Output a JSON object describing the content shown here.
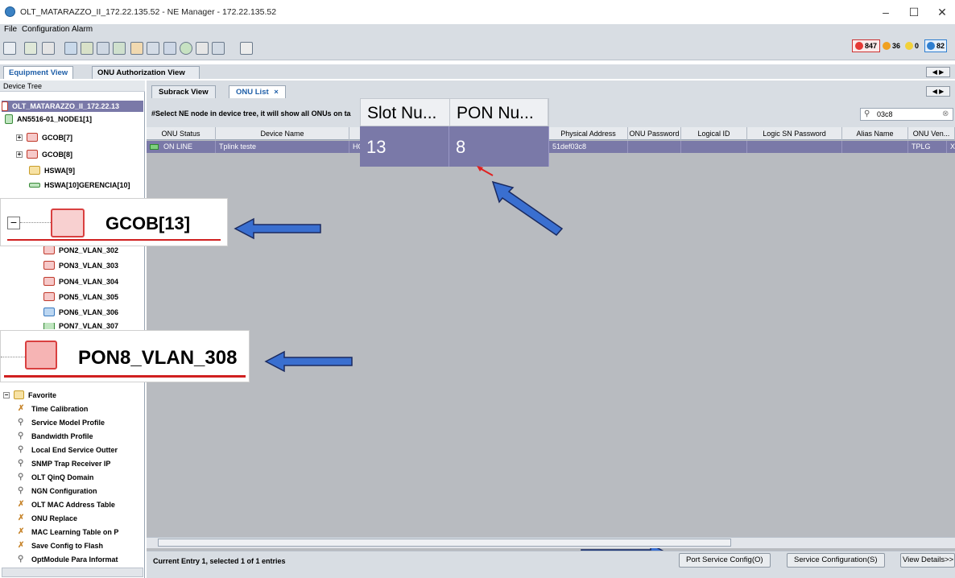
{
  "window": {
    "title": "OLT_MATARAZZO_II_172.22.135.52 - NE Manager - 172.22.135.52",
    "minimize": "–",
    "maximize": "☐",
    "close": "✕"
  },
  "menu": {
    "file": "File",
    "configuration": "Configuration",
    "alarm": "Alarm"
  },
  "alarms": {
    "critical": "847",
    "major": "36",
    "minor": "0",
    "warning": "82",
    "colors": {
      "critical": "#e53935",
      "major": "#f0a020",
      "minor": "#f2d13a",
      "warning": "#2f7fd0"
    }
  },
  "main_tabs": {
    "equipment": "Equipment View",
    "onu_auth": "ONU Authorization View",
    "close": "×"
  },
  "tree": {
    "header": "Device Tree",
    "root": "OLT_MATARAZZO_II_172.22.13",
    "node": "AN5516-01_NODE1[1]",
    "items": [
      "GCOB[7]",
      "GCOB[8]",
      "HSWA[9]",
      "HSWA[10]GERENCIA[10]"
    ],
    "pons": [
      "PON2_VLAN_302",
      "PON3_VLAN_303",
      "PON4_VLAN_304",
      "PON5_VLAN_305",
      "PON6_VLAN_306",
      "PON7_VLAN_307"
    ],
    "favorite": "Favorite",
    "favorites": [
      "Time Calibration",
      "Service Model Profile",
      "Bandwidth Profile",
      "Local End Service Outter",
      "SNMP Trap Receiver IP",
      "OLT QinQ Domain",
      "NGN Configuration",
      "OLT MAC Address Table",
      "ONU Replace",
      "MAC Learning Table on P",
      "Save Config to Flash",
      "OptModule Para Informat"
    ]
  },
  "content_tabs": {
    "subrack": "Subrack View",
    "onu_list": "ONU List",
    "close": "×"
  },
  "info_msg": "#Select NE node in device tree, it will show all ONUs on ta",
  "search": {
    "value": "03c8"
  },
  "table": {
    "headers": [
      "ONU Status",
      "Device Name",
      "HG",
      "Physical Address",
      "ONU Password",
      "Logical ID",
      "Logic SN Password",
      "Alias Name",
      "ONU Ven..."
    ],
    "row": {
      "status": "ON LINE",
      "device_name": "Tplink teste",
      "type": "HG",
      "physical": "51def03c8",
      "password": "",
      "logical_id": "",
      "logic_sn": "",
      "alias": "",
      "vendor": "TPLG",
      "extra": "X"
    }
  },
  "zoom_header": {
    "slot": "Slot Nu...",
    "pon": "PON Nu..."
  },
  "zoom_row": {
    "slot": "13",
    "pon": "8"
  },
  "zoom_card": {
    "label": "GCOB[13]"
  },
  "zoom_pon": {
    "label": "PON8_VLAN_308"
  },
  "status": {
    "text": "Current Entry 1, selected 1 of 1 entries"
  },
  "buttons": {
    "port_service": "Port Service Config(O)",
    "service_config": "Service Configuration(S)",
    "view_details": "View Details>>"
  }
}
